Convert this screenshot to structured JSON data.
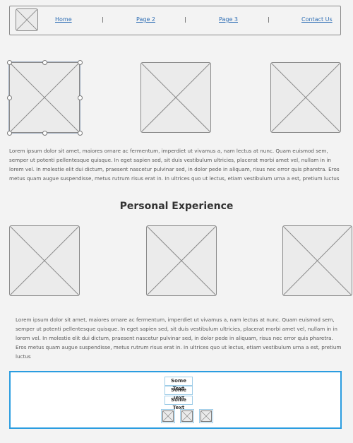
{
  "nav": {
    "links": [
      "Home",
      "Page 2",
      "Page 3",
      "Contact Us"
    ],
    "separator": "|"
  },
  "content": {
    "paragraph_1": "Lorem ipsum dolor sit amet, maiores ornare ac fermentum, imperdiet ut vivamus a, nam lectus at nunc. Quam euismod sem, semper ut potenti pellentesque quisque. In eget sapien sed, sit duis vestibulum ultricies, placerat morbi amet vel, nullam in in lorem vel. In molestie elit dui dictum, praesent nascetur pulvinar sed, in dolor pede in aliquam, risus nec error quis pharetra. Eros metus quam augue suspendisse, metus rutrum risus erat in.  In ultrices quo ut lectus, etiam vestibulum urna a est, pretium luctus",
    "heading": "Personal Experience",
    "paragraph_2": "Lorem ipsum dolor sit amet, maiores ornare ac fermentum, imperdiet ut vivamus a, nam lectus at nunc. Quam euismod sem, semper ut potenti pellentesque quisque. In eget sapien sed, sit duis vestibulum ultricies, placerat morbi amet vel, nullam in in lorem vel. In molestie elit dui dictum, praesent nascetur pulvinar sed, in dolor pede in aliquam, risus nec error quis pharetra. Eros metus quam augue suspendisse, metus rutrum risus erat in.  In ultrices quo ut lectus, etiam vestibulum urna a est, pretium luctus"
  },
  "footer": {
    "texts": [
      "Some Text",
      "Some Text",
      "Some Text"
    ],
    "icons": [
      "image-placeholder-icon",
      "image-placeholder-icon",
      "image-placeholder-icon"
    ]
  },
  "colors": {
    "link": "#2d6db4",
    "footer_border": "#2b9de0",
    "background": "#f3f3f3"
  }
}
